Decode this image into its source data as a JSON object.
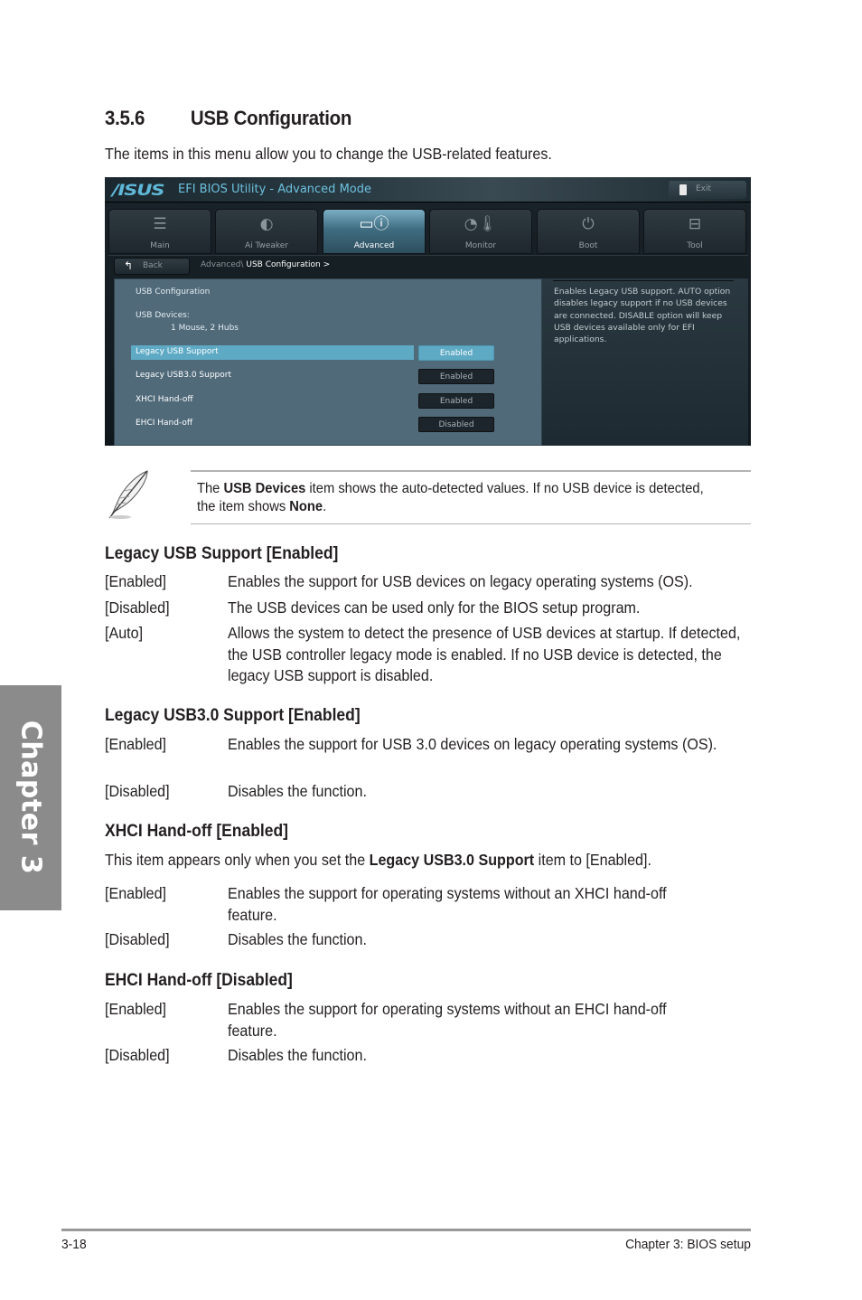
{
  "section": {
    "number": "3.5.6",
    "title": "USB Configuration",
    "intro": "The items in this menu allow you to change the USB-related features."
  },
  "bios": {
    "logo": "/ISUS",
    "title": "EFI BIOS Utility - Advanced Mode",
    "exit_label": "Exit",
    "tabs": [
      {
        "label": "Main",
        "icon": "list-icon",
        "active": false
      },
      {
        "label": "Ai  Tweaker",
        "icon": "tweaker-icon",
        "active": false
      },
      {
        "label": "Advanced",
        "icon": "advanced-info-icon",
        "active": true
      },
      {
        "label": "Monitor",
        "icon": "monitor-thermometer-icon",
        "active": false
      },
      {
        "label": "Boot",
        "icon": "power-icon",
        "active": false
      },
      {
        "label": "Tool",
        "icon": "toolbox-icon",
        "active": false
      }
    ],
    "back_label": "Back",
    "breadcrumb_parent": "Advanced\\",
    "breadcrumb_current": "USB Configuration  >",
    "panel_heading": "USB Configuration",
    "devices_label": "USB Devices:",
    "devices_value": "1 Mouse, 2 Hubs",
    "items": [
      {
        "label": "Legacy USB Support",
        "value": "Enabled",
        "selected": true
      },
      {
        "label": "Legacy USB3.0 Support",
        "value": "Enabled",
        "selected": false
      },
      {
        "label": "XHCI Hand-off",
        "value": "Enabled",
        "selected": false
      },
      {
        "label": "EHCI Hand-off",
        "value": "Disabled",
        "selected": false
      }
    ],
    "help_text": "Enables Legacy USB support. AUTO option disables legacy support if no USB devices are connected. DISABLE option will keep USB devices available only for EFI applications.",
    "colors": {
      "accent": "#5eaac5",
      "panel": "#506a7a",
      "title_text": "#6cc0dd"
    }
  },
  "note": {
    "pre": "The ",
    "bold1": "USB Devices",
    "mid": " item shows the auto-detected values. If no USB device is detected, the item shows ",
    "bold2": "None",
    "post": "."
  },
  "descriptions": {
    "legacy_usb": {
      "heading": "Legacy USB Support [Enabled]",
      "options": [
        {
          "option": "[Enabled]",
          "text": "Enables the support for USB devices on legacy operating systems (OS)."
        },
        {
          "option": "[Disabled]",
          "text": "The USB devices can be used only for the BIOS setup program."
        },
        {
          "option": "[Auto]",
          "text": "Allows the system to detect the presence of USB devices at startup. If detected, the USB controller legacy mode is enabled. If no USB device is detected, the legacy USB support is disabled."
        }
      ]
    },
    "legacy_usb3": {
      "heading": "Legacy USB3.0 Support [Enabled]",
      "options": [
        {
          "option": "[Enabled]",
          "text": "Enables the support for USB 3.0 devices on legacy operating systems (OS)."
        },
        {
          "option": "[Disabled]",
          "text": "Disables the function."
        }
      ]
    },
    "xhci": {
      "heading": "XHCI Hand-off [Enabled]",
      "note_pre": "This item appears only when you set the ",
      "note_bold": "Legacy USB3.0 Support",
      "note_post": " item to [Enabled].",
      "options": [
        {
          "option": "[Enabled]",
          "text": "Enables the support for operating systems without an XHCI hand-off feature."
        },
        {
          "option": "[Disabled]",
          "text": "Disables the function."
        }
      ]
    },
    "ehci": {
      "heading": "EHCI Hand-off [Disabled]",
      "options": [
        {
          "option": "[Enabled]",
          "text": "Enables the support for operating systems without an EHCI hand-off feature."
        },
        {
          "option": "[Disabled]",
          "text": "Disables the function."
        }
      ]
    }
  },
  "chapter_tab": "Chapter 3",
  "footer": {
    "page": "3-18",
    "chapter": "Chapter 3: BIOS setup"
  }
}
